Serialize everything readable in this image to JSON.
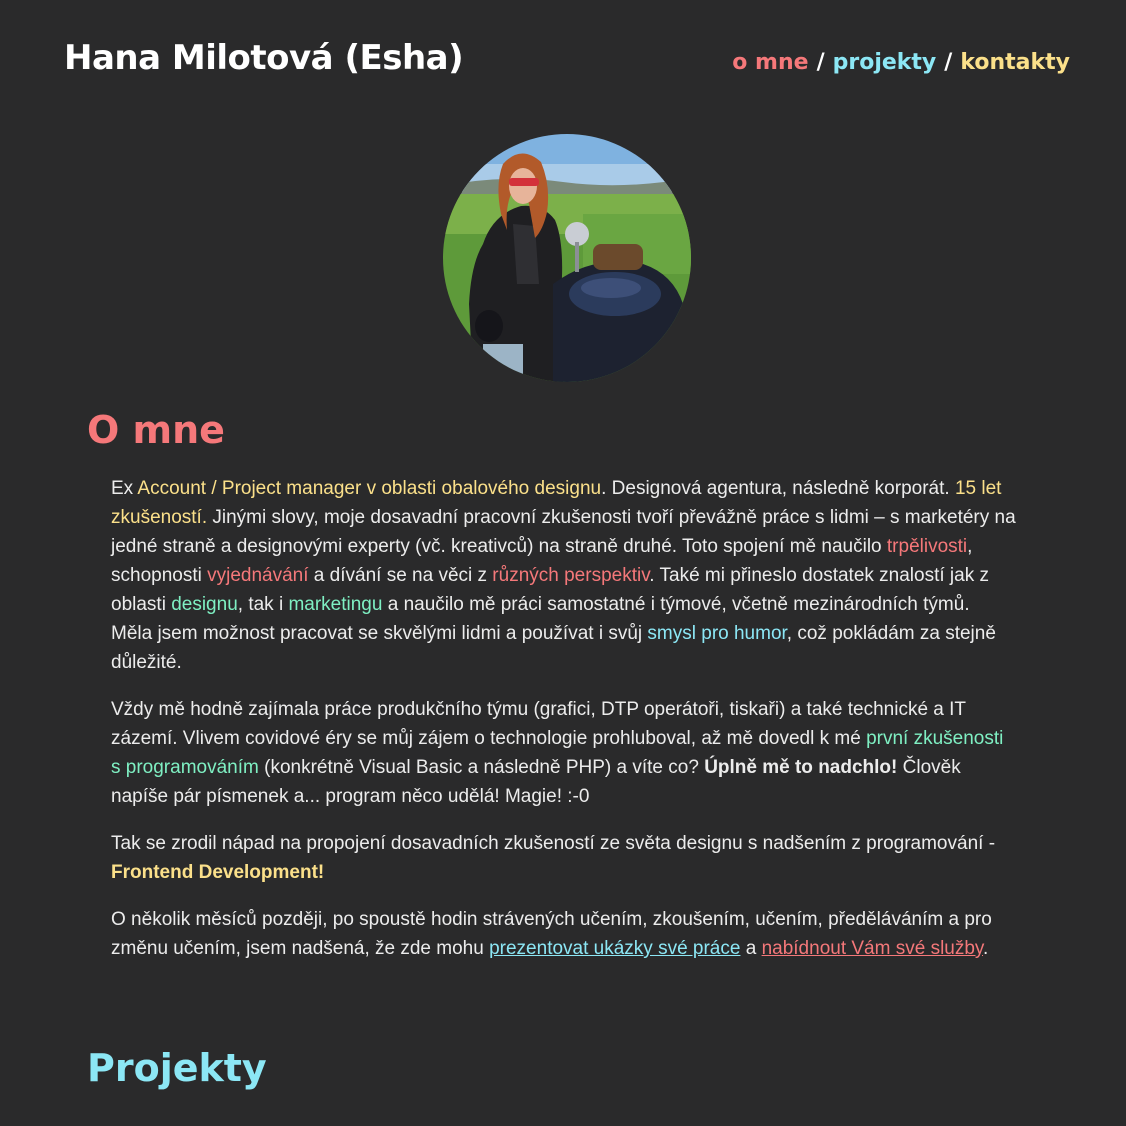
{
  "header": {
    "site_title": "Hana Milotová (Esha)",
    "nav": {
      "about": "o mne",
      "separator": "/",
      "projects": "projekty",
      "contacts": "kontakty"
    }
  },
  "avatar": {
    "icon": "profile-photo"
  },
  "about": {
    "title": "O mne",
    "p1": {
      "t1": "Ex ",
      "h1": "Account / Project manager v oblasti obalového designu",
      "t2": ". Designová agentura, následně korporát. ",
      "h2": "15 let zkušeností.",
      "t3": " Jinými slovy, moje dosavadní pracovní zkušenosti tvoří převážně práce s lidmi – s marketéry na jedné straně a designovými experty (vč. kreativců) na straně druhé. Toto spojení mě naučilo ",
      "h3": "trpělivosti",
      "t4": ", schopnosti ",
      "h4": "vyjednávání",
      "t5": " a dívání se na věci z  ",
      "h5": "různých perspektiv",
      "t6": ". Také mi přineslo dostatek znalostí jak z oblasti ",
      "h6": "designu",
      "t7": ", tak i ",
      "h7": "marketingu",
      "t8": " a naučilo mě práci samostatné i týmové, včetně mezinárodních týmů. Měla jsem možnost pracovat se skvělými lidmi a používat i svůj ",
      "h8": "smysl pro humor",
      "t9": ", což pokládám za stejně důležité."
    },
    "p2": {
      "t1": "Vždy mě hodně zajímala práce produkčního týmu (grafici, DTP operátoři, tiskaři) a také technické a IT zázemí. Vlivem covidové éry se můj zájem o technologie prohluboval, až mě dovedl k mé ",
      "h1": "první zkušenosti s programováním",
      "t2": " (konkrétně Visual Basic a následně PHP) a víte co? ",
      "b1": "Úplně mě to nadchlo!",
      "t3": " Člověk napíše pár písmenek a... program něco udělá! Magie! :-0"
    },
    "p3": {
      "t1": "Tak se zrodil nápad na propojení dosavadních zkušeností ze světa designu s nadšením z programování - ",
      "b1": "Frontend Development!"
    },
    "p4": {
      "t1": "O několik měsíců později, po spoustě hodin strávených učením, zkoušením, učením, předěláváním a pro změnu učením, jsem nadšená, že zde mohu ",
      "l1": "prezentovat ukázky své práce",
      "t2": " a  ",
      "l2": "nabídnout Vám své služby",
      "t3": "."
    }
  },
  "projects": {
    "title": "Projekty"
  },
  "colors": {
    "background": "#2a2a2b",
    "red": "#f5787a",
    "cyan": "#8ce7f5",
    "yellow": "#fbe08a",
    "green": "#7ff0c3"
  }
}
